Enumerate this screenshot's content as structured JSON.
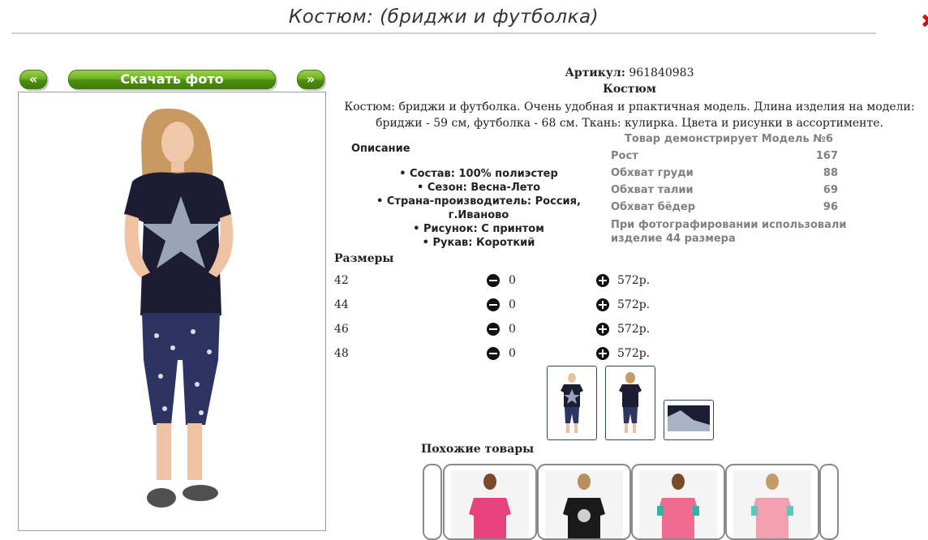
{
  "page": {
    "title": "Костюм: (бриджи и футболка)"
  },
  "gallery": {
    "prev_label": "«",
    "download_label": "Скачать фото",
    "next_label": "»"
  },
  "product": {
    "article_label": "Артикул:",
    "article_value": "961840983",
    "name": "Костюм",
    "description": "Костюм: бриджи и футболка. Очень удобная и рпактичная модель. Длина изделия на модели: бриджи - 59 см, футболка - 68 см. Ткань: кулирка. Цвета и рисунки в ассортименте.",
    "description_heading": "Описание",
    "properties": [
      "Состав: 100% полиэстер",
      "Сезон: Весна-Лето",
      "Страна-производитель: Россия, г.Иваново",
      "Рисунок: С принтом",
      "Рукав: Короткий"
    ]
  },
  "model": {
    "heading": "Товар демонстрирует Модель №6",
    "rows": [
      {
        "label": "Рост",
        "value": "167"
      },
      {
        "label": "Обхват груди",
        "value": "88"
      },
      {
        "label": "Обхват талии",
        "value": "69"
      },
      {
        "label": "Обхват бёдер",
        "value": "96"
      }
    ],
    "note": "При фотографировании использовали изделие 44 размера"
  },
  "sizes": {
    "heading": "Размеры",
    "rows": [
      {
        "size": "42",
        "qty": "0",
        "price": "572р."
      },
      {
        "size": "44",
        "qty": "0",
        "price": "572р."
      },
      {
        "size": "46",
        "qty": "0",
        "price": "572р."
      },
      {
        "size": "48",
        "qty": "0",
        "price": "572р."
      }
    ]
  },
  "similar": {
    "heading": "Похожие товары"
  },
  "icons": {
    "minus": "minus-circle-icon",
    "plus": "plus-circle-icon",
    "close": "close-icon"
  },
  "colors": {
    "button_green": "#6fb321",
    "shirt_navy": "#1c1d33",
    "leggings_navy": "#2e3461",
    "card_pink": "#e8427c"
  }
}
